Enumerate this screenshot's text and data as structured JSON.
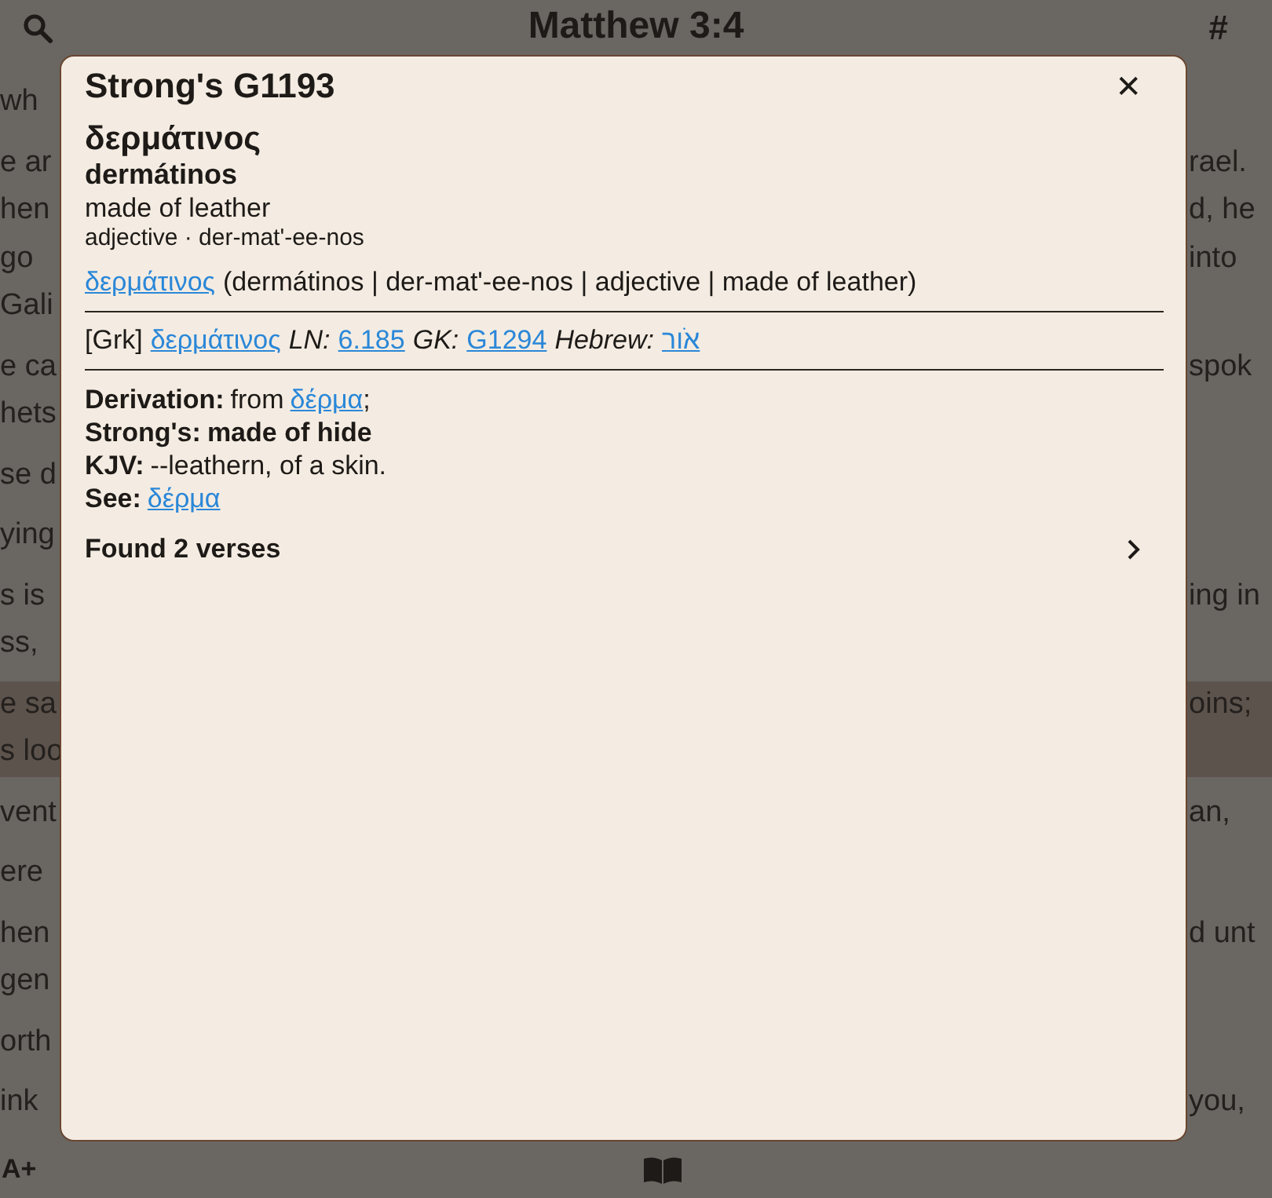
{
  "header": {
    "title": "Matthew 3:4",
    "hash": "#"
  },
  "reader": {
    "paragraphs": [
      {
        "highlighted": false,
        "lines": [
          {
            "left": "wh"
          }
        ]
      },
      {
        "highlighted": false,
        "lines": [
          {
            "left": "e ar",
            "right": "rael."
          },
          {
            "left": "hen",
            "right": "d, he"
          },
          {
            "left": "go",
            "right": "into"
          },
          {
            "left": "Gali"
          }
        ]
      },
      {
        "highlighted": false,
        "lines": [
          {
            "left": "e ca",
            "right": "spok"
          },
          {
            "left": "hets"
          }
        ]
      },
      {
        "highlighted": false,
        "lines": [
          {
            "left": "se d"
          }
        ]
      },
      {
        "highlighted": false,
        "lines": [
          {
            "left": "ying"
          }
        ]
      },
      {
        "highlighted": false,
        "lines": [
          {
            "left": "s is",
            "right": "ing in"
          },
          {
            "left": "ss,"
          }
        ]
      },
      {
        "highlighted": true,
        "lines": [
          {
            "left": "e sa",
            "right": "oins;"
          },
          {
            "left": "s loo"
          }
        ]
      },
      {
        "highlighted": false,
        "lines": [
          {
            "left": "vent",
            "right": "an,"
          }
        ]
      },
      {
        "highlighted": false,
        "lines": [
          {
            "left": "ere"
          }
        ]
      },
      {
        "highlighted": false,
        "lines": [
          {
            "left": "hen",
            "right": "d unt"
          },
          {
            "left": "gen"
          }
        ]
      },
      {
        "highlighted": false,
        "lines": [
          {
            "left": "orth"
          }
        ]
      },
      {
        "highlighted": false,
        "lines": [
          {
            "left": "ink",
            "right": "you,"
          }
        ]
      }
    ]
  },
  "toolbar": {
    "font_size": "A+"
  },
  "dialog": {
    "title": "Strong's G1193",
    "close": "✕",
    "lemma": "δερμάτινος",
    "transliteration": "dermátinos",
    "gloss": "made of leather",
    "pos_line": "adjective · der-mat'-ee-nos",
    "summary": {
      "link": "δερμάτινος",
      "text": "(dermátinos | der-mat'-ee-nos | adjective | made of leather)"
    },
    "refs": [
      {
        "kind": "plain",
        "text": "[Grk]"
      },
      {
        "kind": "link",
        "text": "δερμάτινος"
      },
      {
        "kind": "label",
        "text": "LN:"
      },
      {
        "kind": "link",
        "text": "6.185"
      },
      {
        "kind": "label",
        "text": "GK:"
      },
      {
        "kind": "link",
        "text": "G1294"
      },
      {
        "kind": "label",
        "text": "Hebrew:"
      },
      {
        "kind": "link",
        "text": "אֹור"
      }
    ],
    "definitions": [
      {
        "label": "Derivation:",
        "parts": [
          {
            "kind": "plain",
            "text": "from"
          },
          {
            "kind": "link",
            "text": "δέρμα"
          },
          {
            "kind": "punct",
            "text": ";"
          }
        ]
      },
      {
        "label": "Strong's:",
        "parts": [
          {
            "kind": "bold",
            "text": "made of hide"
          }
        ]
      },
      {
        "label": "KJV:",
        "parts": [
          {
            "kind": "plain",
            "text": "--leathern, of a skin."
          }
        ]
      },
      {
        "label": "See:",
        "parts": [
          {
            "kind": "link",
            "text": "δέρμα"
          }
        ]
      }
    ],
    "found": "Found 2 verses"
  }
}
